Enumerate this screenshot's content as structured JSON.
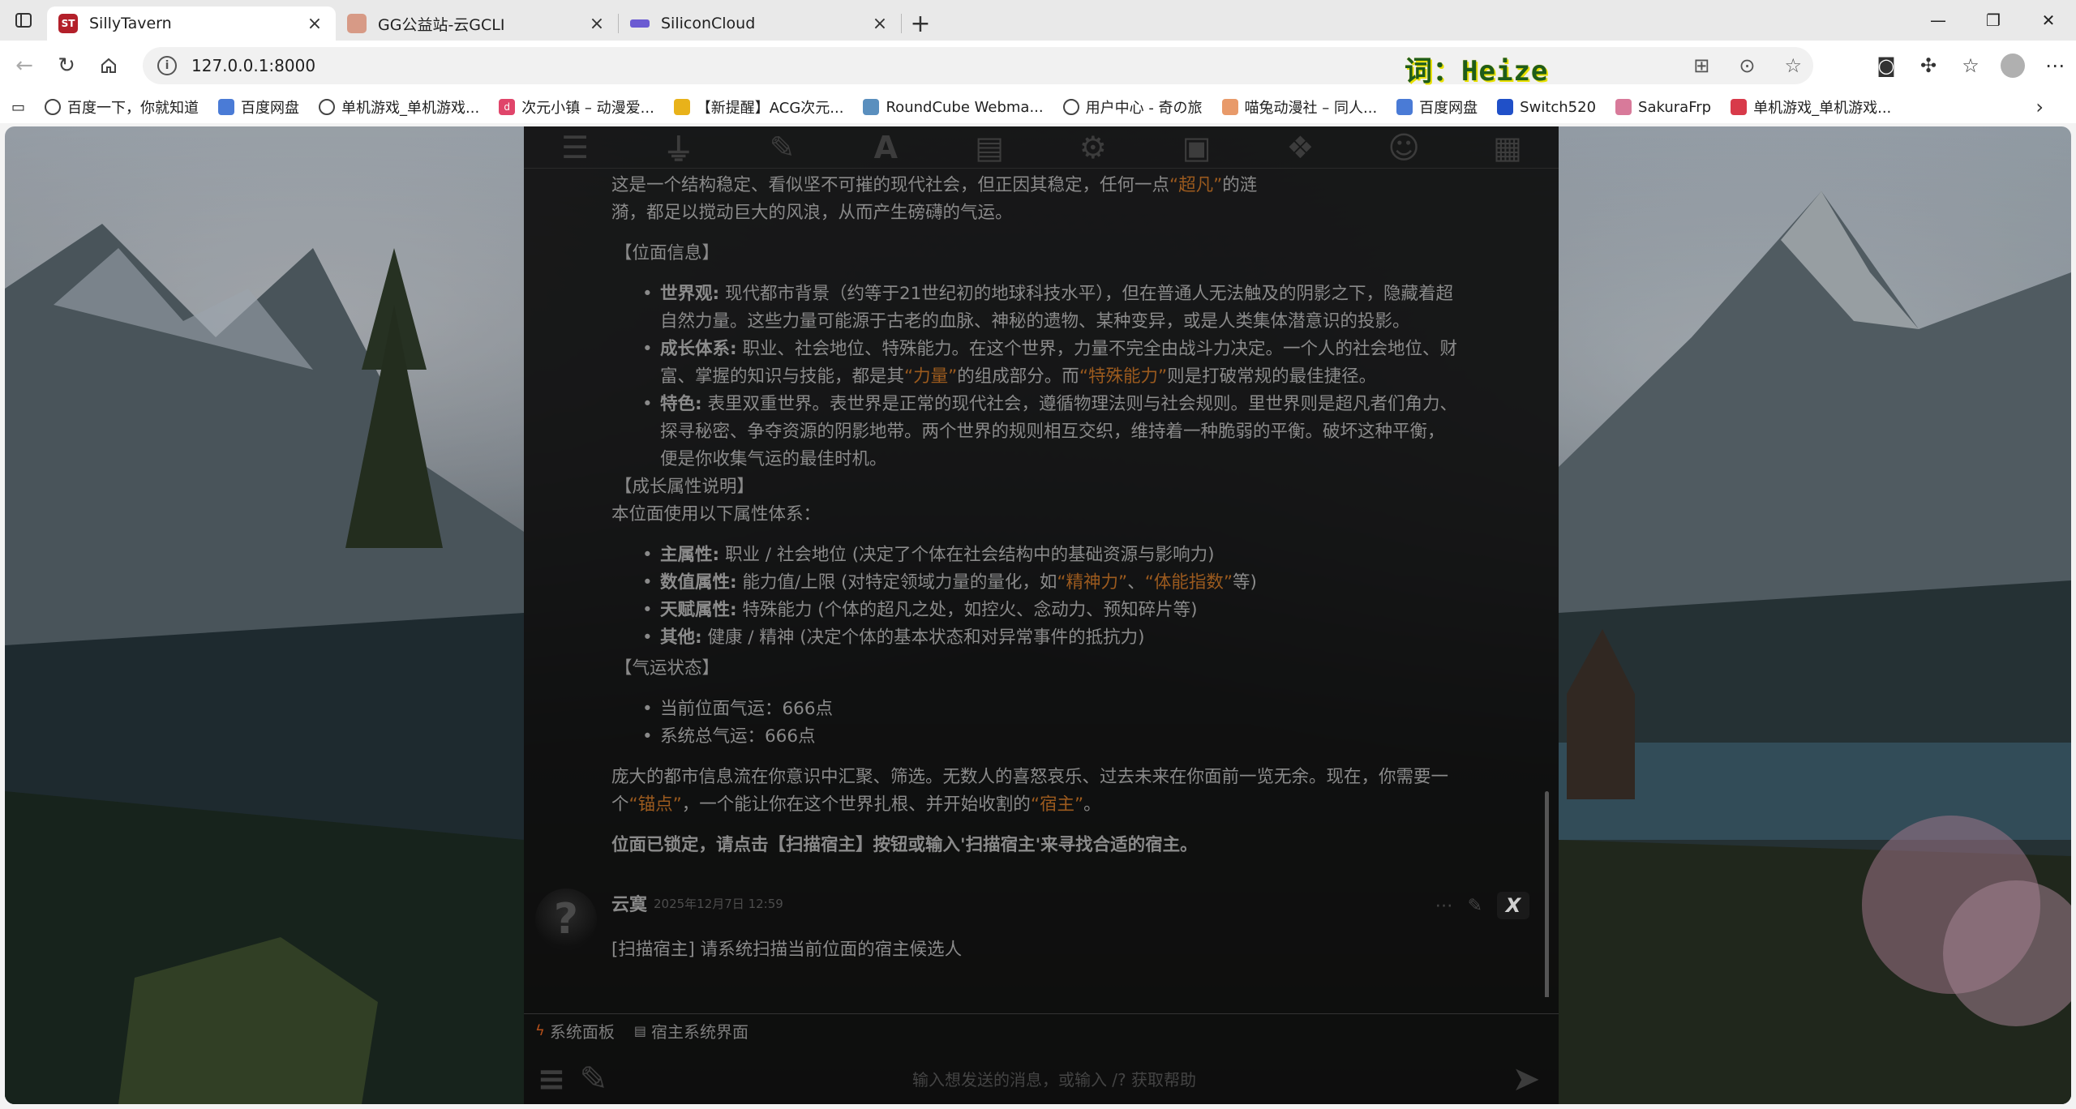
{
  "browser": {
    "tabs": [
      {
        "title": "SillyTavern",
        "favicon": "ST",
        "color": "#b3202a",
        "active": true
      },
      {
        "title": "GG公益站-云GCLI",
        "favicon": "",
        "color": "#d79a86",
        "active": false
      },
      {
        "title": "SiliconCloud",
        "favicon": "",
        "color": "#6b5bd2",
        "active": false
      }
    ],
    "url": "127.0.0.1:8000",
    "address_overlay_text": "词：Heize",
    "bookmarks": [
      {
        "label": "百度一下，你就知道",
        "icon": "globe-icon"
      },
      {
        "label": "百度网盘",
        "icon": "baidu-pan-icon"
      },
      {
        "label": "单机游戏_单机游戏...",
        "icon": "globe-icon"
      },
      {
        "label": "次元小镇 – 动漫爱...",
        "icon": "d-icon"
      },
      {
        "label": "【新提醒】ACG次元...",
        "icon": "trophy-icon"
      },
      {
        "label": "RoundCube Webma...",
        "icon": "cube-icon"
      },
      {
        "label": "用户中心 - 奇の旅",
        "icon": "globe-icon"
      },
      {
        "label": "喵兔动漫社 – 同人...",
        "icon": "paw-icon"
      },
      {
        "label": "百度网盘",
        "icon": "baidu-pan-icon"
      },
      {
        "label": "Switch520",
        "icon": "switch-icon"
      },
      {
        "label": "SakuraFrp",
        "icon": "sakura-icon"
      },
      {
        "label": "单机游戏_单机游戏...",
        "icon": "game-icon"
      }
    ]
  },
  "chat": {
    "m1": {
      "intro_a": "这是一个结构稳定、看似坚不可摧的现代社会，但正因其稳定，任何一点",
      "intro_q": "“超凡”",
      "intro_b": "的涟",
      "intro2": "漪，都足以搅动巨大的风浪，从而产生磅礴的气运。",
      "h_info": "【位面信息】",
      "li1_label": "世界观:",
      "li1_text": " 现代都市背景（约等于21世纪初的地球科技水平），但在普通人无法触及的阴影之下，隐藏着超",
      "li1_text2": "自然力量。这些力量可能源于古老的血脉、神秘的遗物、某种变异，或是人类集体潜意识的投影。",
      "li2_label": "成长体系:",
      "li2_text": " 职业、社会地位、特殊能力。在这个世界，力量不完全由战斗力决定。一个人的社会地位、财",
      "li2_text2a": "富、掌握的知识与技能，都是其",
      "li2_q1": "“力量”",
      "li2_text2b": "的组成部分。而",
      "li2_q2": "“特殊能力”",
      "li2_text2c": "则是打破常规的最佳捷径。",
      "li3_label": "特色:",
      "li3_text": " 表里双重世界。表世界是正常的现代社会，遵循物理法则与社会规则。里世界则是超凡者们角力、",
      "li3_text2": "探寻秘密、争夺资源的阴影地带。两个世界的规则相互交织，维持着一种脆弱的平衡。破坏这种平衡，",
      "li3_text3": "便是你收集气运的最佳时机。",
      "h_growth": "【成长属性说明】",
      "growth_intro": "本位面使用以下属性体系：",
      "a1_label": "主属性:",
      "a1_text": " 职业 / 社会地位 (决定了个体在社会结构中的基础资源与影响力)",
      "a2_label": "数值属性:",
      "a2_text_a": " 能力值/上限 (对特定领域力量的量化，如",
      "a2_q1": "“精神力”",
      "a2_sep": "、",
      "a2_q2": "“体能指数”",
      "a2_text_b": "等)",
      "a3_label": "天赋属性:",
      "a3_text": " 特殊能力 (个体的超凡之处，如控火、念动力、预知碎片等)",
      "a4_label": "其他:",
      "a4_text": " 健康 / 精神 (决定个体的基本状态和对异常事件的抵抗力)",
      "h_luck": "【气运状态】",
      "luck1": "当前位面气运：666点",
      "luck2": "系统总气运：666点",
      "out_a": "庞大的都市信息流在你意识中汇聚、筛选。无数人的喜怒哀乐、过去未来在你面前一览无余。现在，你需要一",
      "out_b1": "个",
      "out_q1": "“锚点”",
      "out_b2": "，一个能让你在这个世界扎根、并开始收割的",
      "out_q2": "“宿主”",
      "out_b3": "。",
      "final": "位面已锁定，请点击【扫描宿主】按钮或输入'扫描宿主'来寻找合适的宿主。"
    },
    "m2": {
      "name": "云寞",
      "time": "2025年12月7日 12:59",
      "text": "[扫描宿主] 请系统扫描当前位面的宿主候选人"
    },
    "quick": {
      "b1": "系统面板",
      "b2": "宿主系统界面"
    },
    "input_placeholder": "输入想发送的消息，或输入 /? 获取帮助"
  }
}
